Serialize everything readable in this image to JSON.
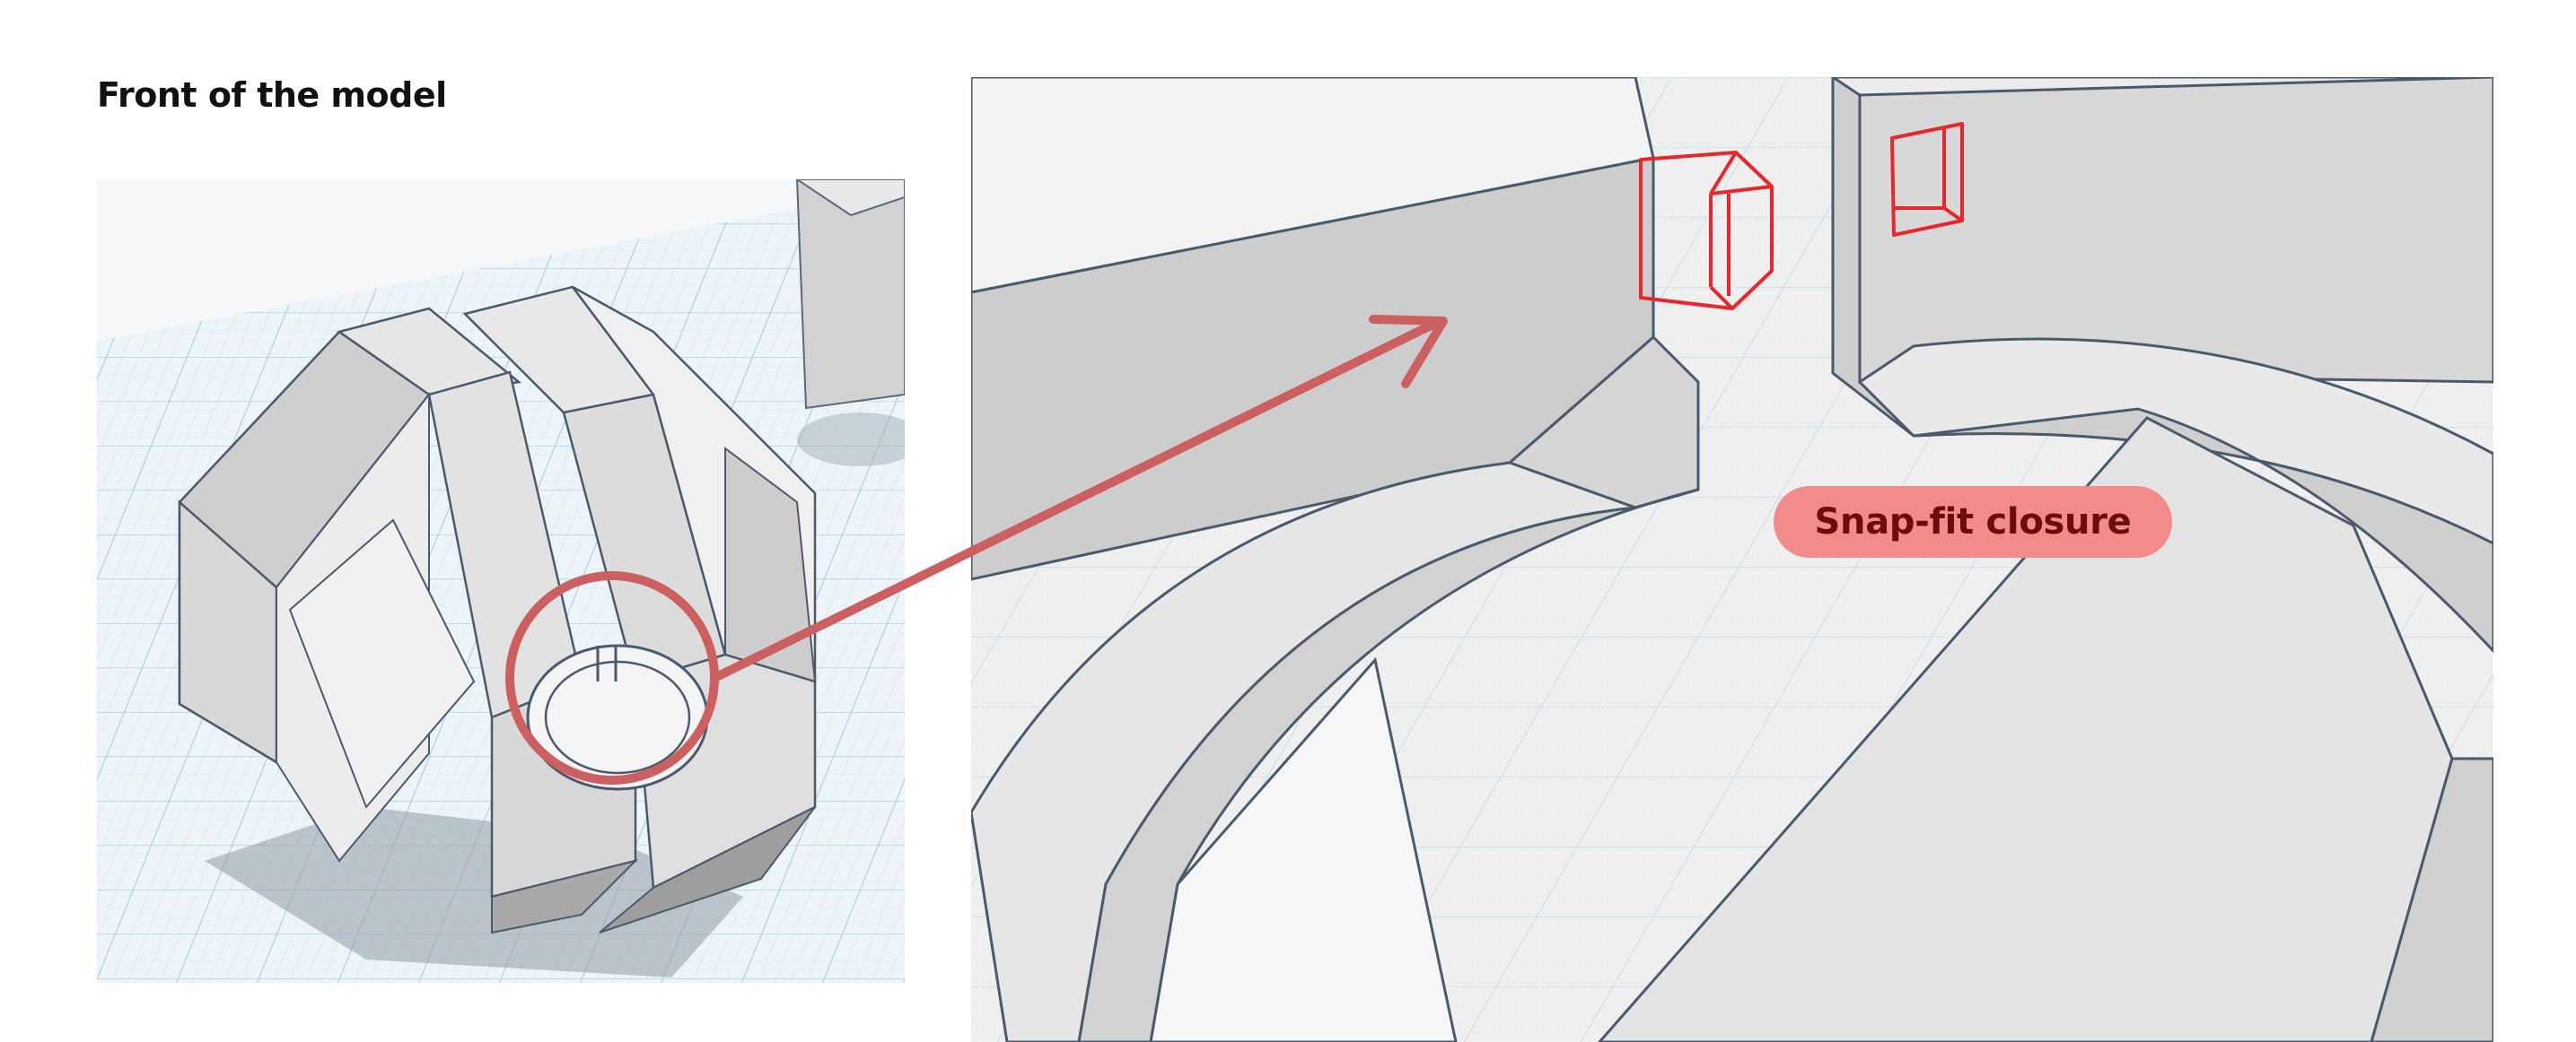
{
  "heading": {
    "title": "Front of the model"
  },
  "callout": {
    "label": "Snap-fit closure"
  },
  "colors": {
    "accent": "#cc5f5f",
    "badge_bg": "#f28b8b",
    "badge_text": "#6b0d0d",
    "marker": "#e8262c",
    "workplane": "#eef4f8",
    "grid": "#b7d8ea",
    "model_face": "#e4e4e4",
    "model_shade": "#c9c9c9",
    "model_edge": "#4a5a6c"
  },
  "icons": [
    "zoom-arrow-icon",
    "magnify-circle-icon",
    "snap-tab-marker-icon"
  ]
}
